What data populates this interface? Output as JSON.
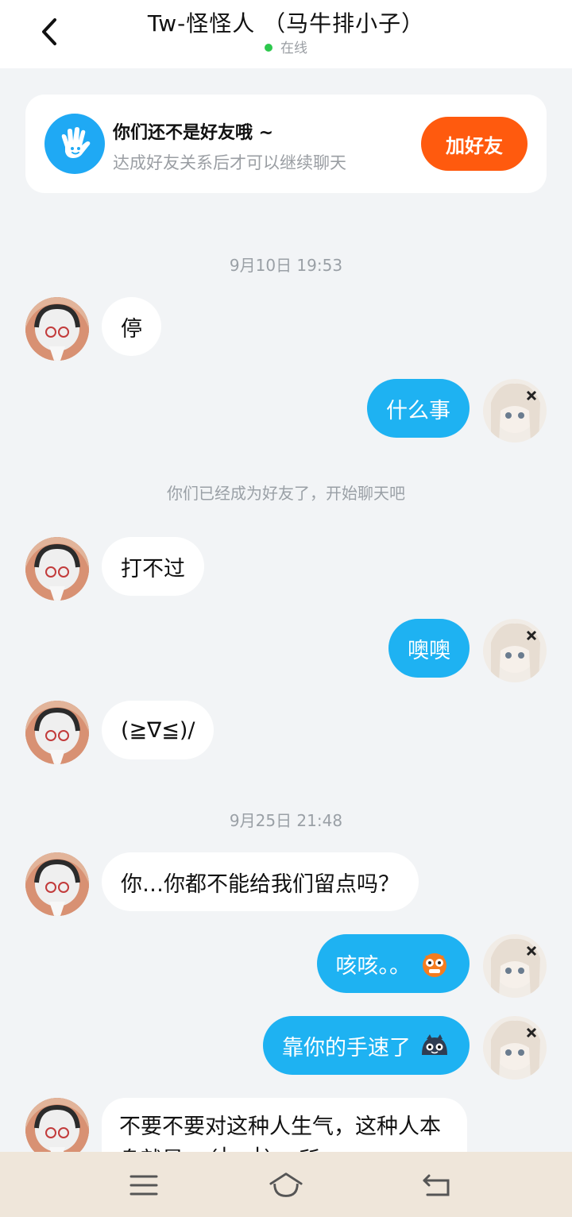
{
  "header": {
    "title": "Tw-怪怪人 （马牛排小子）",
    "status": "在线",
    "status_color": "#2dc84d"
  },
  "friend_notice": {
    "title": "你们还不是好友哦 ~",
    "subtitle": "达成好友关系后才可以继续聊天",
    "button": "加好友",
    "button_color": "#ff5a0e",
    "icon_bg": "#1fa9f4",
    "icon": "wave-hand-icon"
  },
  "chat": {
    "timestamps": [
      "9月10日 19:53",
      "9月25日 21:48"
    ],
    "system_notice": "你们已经成为好友了，开始聊天吧",
    "messages": [
      {
        "from": "other",
        "text": "停"
      },
      {
        "from": "me",
        "text": "什么事"
      },
      {
        "from": "other",
        "text": "打不过"
      },
      {
        "from": "me",
        "text": "噢噢"
      },
      {
        "from": "other",
        "text": "(≧∇≦)/"
      },
      {
        "from": "other",
        "text": "你…你都不能给我们留点吗？"
      },
      {
        "from": "me",
        "text": "咳咳。。",
        "emoji": "orange-monster-emoji"
      },
      {
        "from": "me",
        "text": "靠你的手速了",
        "emoji": "dark-blob-emoji"
      },
      {
        "from": "other",
        "text": "不要不要对这种人生气，这种人本身就是╮（╯□╰）╭所"
      }
    ],
    "bubble_out_color": "#1eb2f2",
    "bubble_in_color": "#ffffff"
  },
  "nav": {
    "items": [
      "menu-icon",
      "home-icon",
      "back-icon"
    ]
  }
}
